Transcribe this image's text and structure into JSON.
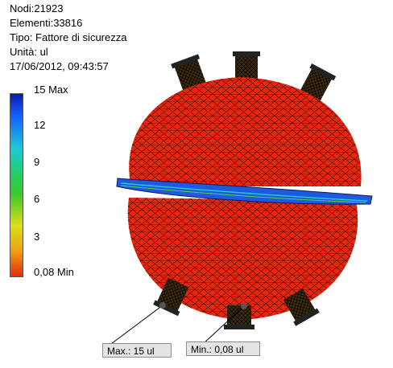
{
  "info": {
    "nodes": "Nodi:21923",
    "elements": "Elementi:33816",
    "type": "Tipo: Fattore di sicurezza",
    "unit": "Unità: ul",
    "timestamp": "17/06/2012, 09:43:57"
  },
  "legend": {
    "ticks": [
      "15 Max",
      "12",
      "9",
      "6",
      "3",
      "0,08 Min"
    ],
    "colors": [
      "#0a1ab0",
      "#1560ff",
      "#1ec8d8",
      "#22d05a",
      "#d8e01a",
      "#e62a10"
    ]
  },
  "model": {
    "fill_color": "#e8260e",
    "mesh_color": "#000000",
    "flange_color": "#1e5ae0"
  },
  "callouts": {
    "max_label": "Max.: 15 ul",
    "min_label": "Min.: 0,08 ul"
  }
}
